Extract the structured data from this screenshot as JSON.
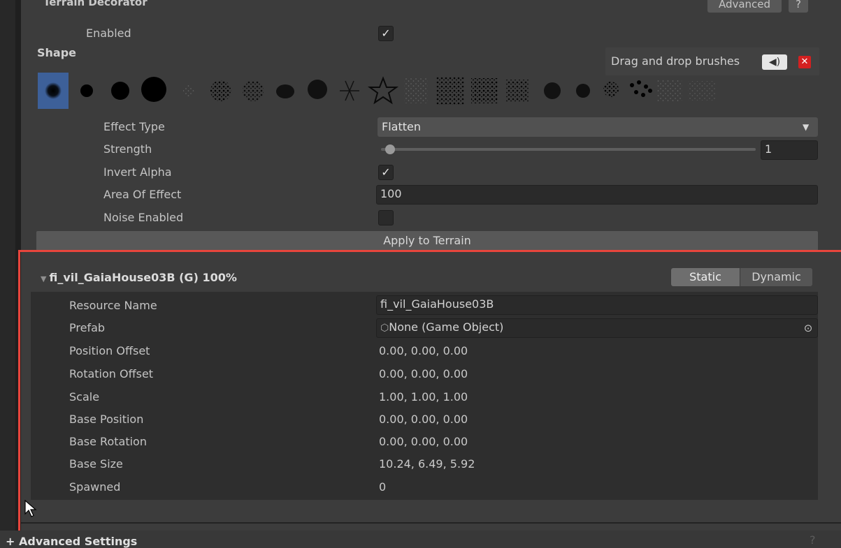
{
  "decorator": {
    "title": "Terrain Decorator",
    "advanced_label": "Advanced",
    "help_label": "?",
    "enabled_label": "Enabled",
    "enabled_checked": true
  },
  "shape": {
    "label": "Shape",
    "drag_drop_label": "Drag and drop brushes",
    "selected_index": 0
  },
  "effect": {
    "type_label": "Effect Type",
    "type_value": "Flatten",
    "strength_label": "Strength",
    "strength_value": "1",
    "strength_fraction": 0.02,
    "invert_alpha_label": "Invert Alpha",
    "invert_alpha_checked": true,
    "area_label": "Area Of Effect",
    "area_value": "100",
    "noise_label": "Noise Enabled",
    "noise_checked": false,
    "apply_label": "Apply to Terrain"
  },
  "resource": {
    "title": "fi_vil_GaiaHouse03B (G) 100%",
    "static_label": "Static",
    "dynamic_label": "Dynamic",
    "fields": {
      "resource_name_label": "Resource Name",
      "resource_name_value": "fi_vil_GaiaHouse03B",
      "prefab_label": "Prefab",
      "prefab_value": "None (Game Object)",
      "position_offset_label": "Position Offset",
      "position_offset_value": "0.00, 0.00, 0.00",
      "rotation_offset_label": "Rotation Offset",
      "rotation_offset_value": "0.00, 0.00, 0.00",
      "scale_label": "Scale",
      "scale_value": "1.00, 1.00, 1.00",
      "base_position_label": "Base Position",
      "base_position_value": "0.00, 0.00, 0.00",
      "base_rotation_label": "Base Rotation",
      "base_rotation_value": "0.00, 0.00, 0.00",
      "base_size_label": "Base Size",
      "base_size_value": "10.24, 6.49, 5.92",
      "spawned_label": "Spawned",
      "spawned_value": "0"
    }
  },
  "footer": {
    "advanced_settings_label": "+ Advanced Settings",
    "help_label": "?"
  },
  "colors": {
    "highlight": "#e8453c",
    "selected_brush": "#3d6099",
    "close_button": "#d32020"
  }
}
